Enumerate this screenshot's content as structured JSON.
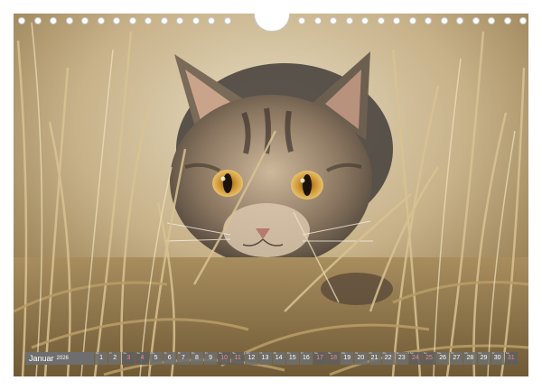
{
  "calendar": {
    "month": "Januar",
    "year": "2026",
    "days": [
      {
        "num": "1",
        "wd": "Do",
        "weekend": false
      },
      {
        "num": "2",
        "wd": "Fr",
        "weekend": false
      },
      {
        "num": "3",
        "wd": "Sa",
        "weekend": true
      },
      {
        "num": "4",
        "wd": "So",
        "weekend": true
      },
      {
        "num": "5",
        "wd": "Mo",
        "weekend": false
      },
      {
        "num": "6",
        "wd": "Di",
        "weekend": false
      },
      {
        "num": "7",
        "wd": "Mi",
        "weekend": false
      },
      {
        "num": "8",
        "wd": "Do",
        "weekend": false
      },
      {
        "num": "9",
        "wd": "Fr",
        "weekend": false
      },
      {
        "num": "10",
        "wd": "Sa",
        "weekend": true
      },
      {
        "num": "11",
        "wd": "So",
        "weekend": true
      },
      {
        "num": "12",
        "wd": "Mo",
        "weekend": false
      },
      {
        "num": "13",
        "wd": "Di",
        "weekend": false
      },
      {
        "num": "14",
        "wd": "Mi",
        "weekend": false
      },
      {
        "num": "15",
        "wd": "Do",
        "weekend": false
      },
      {
        "num": "16",
        "wd": "Fr",
        "weekend": false
      },
      {
        "num": "17",
        "wd": "Sa",
        "weekend": true
      },
      {
        "num": "18",
        "wd": "So",
        "weekend": true
      },
      {
        "num": "19",
        "wd": "Mo",
        "weekend": false
      },
      {
        "num": "20",
        "wd": "Di",
        "weekend": false
      },
      {
        "num": "21",
        "wd": "Mi",
        "weekend": false
      },
      {
        "num": "22",
        "wd": "Do",
        "weekend": false
      },
      {
        "num": "23",
        "wd": "Fr",
        "weekend": false
      },
      {
        "num": "24",
        "wd": "Sa",
        "weekend": true
      },
      {
        "num": "25",
        "wd": "So",
        "weekend": true
      },
      {
        "num": "26",
        "wd": "Mo",
        "weekend": false
      },
      {
        "num": "27",
        "wd": "Di",
        "weekend": false
      },
      {
        "num": "28",
        "wd": "Mi",
        "weekend": false
      },
      {
        "num": "29",
        "wd": "Do",
        "weekend": false
      },
      {
        "num": "30",
        "wd": "Fr",
        "weekend": false
      },
      {
        "num": "31",
        "wd": "Sa",
        "weekend": true
      }
    ]
  },
  "colors": {
    "strip_background": "#6e6e6e",
    "weekend_text": "#f08a8a",
    "weekday_text": "#ffffff"
  },
  "photo": {
    "subject": "tabby-kitten-in-dry-grass"
  }
}
